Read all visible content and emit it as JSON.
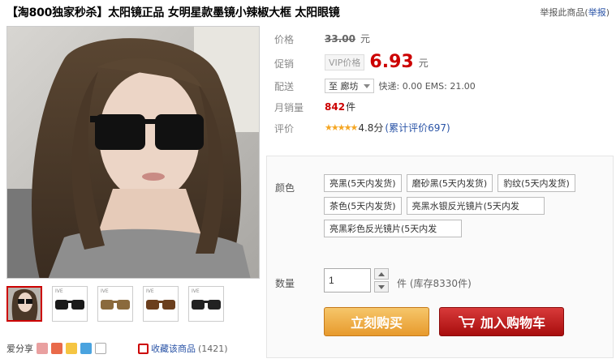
{
  "product": {
    "title": "【淘800独家秒杀】太阳镜正品 女明星款墨镜小辣椒大框 太阳眼镜",
    "report_text": "举报此商品(",
    "report_link": "举报",
    "report_close": ")"
  },
  "thumbs": [
    {
      "label": "",
      "frame": "#c00",
      "lens": "#222"
    },
    {
      "label": "IVE",
      "frame": "#1a1a1a",
      "lens": "#333"
    },
    {
      "label": "IVE",
      "frame": "#8a6a3d",
      "lens": "#6a4a2a"
    },
    {
      "label": "IVE",
      "frame": "#6b3f1e",
      "lens": "#4a2c15"
    },
    {
      "label": "IVE",
      "frame": "#222",
      "lens": "#666"
    }
  ],
  "share": {
    "label": "爱分享",
    "icons": [
      "share-qq-icon",
      "share-weibo-icon",
      "share-qzone-icon",
      "share-other-icon",
      "share-more-icon"
    ],
    "fav_label": "收藏该商品",
    "fav_count": "(1421)"
  },
  "props": {
    "price_label": "价格",
    "old_price": "33.00",
    "yuan": "元",
    "promo_label": "促销",
    "vip_label": "VIP价格",
    "promo_price": "6.93",
    "ship_label": "配送",
    "ship_to": "至 廊坊",
    "ship_fee": "快递: 0.00 EMS: 21.00",
    "sales_label": "月销量",
    "sales_count": "842",
    "sales_unit": "件",
    "rating_label": "评价",
    "stars": "★★★★★",
    "score": "4.8分",
    "rating_count": "(累计评价697)"
  },
  "options": {
    "color_label": "颜色",
    "colors": [
      "亮黑(5天内发货)",
      "磨砂黑(5天内发货)",
      "豹纹(5天内发货)",
      "茶色(5天内发货)",
      "亮黑水银反光镜片(5天内发",
      "亮黑彩色反光镜片(5天内发"
    ],
    "qty_label": "数量",
    "qty_value": "1",
    "qty_unit": "件",
    "stock": "(库存8330件)",
    "buy_label": "立刻购买",
    "cart_label": "加入购物车"
  },
  "colors": {
    "price_red": "#cc0000",
    "buy_orange": "#e79a2d",
    "cart_red": "#a80d0d",
    "link_blue": "#2953a6"
  }
}
